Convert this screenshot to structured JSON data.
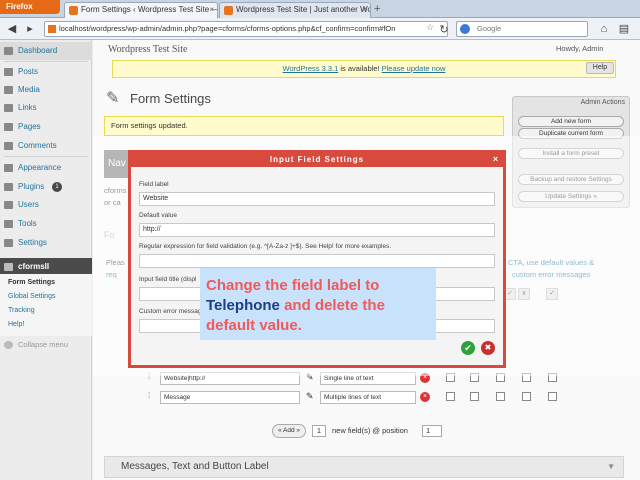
{
  "browser": {
    "app_button": "Firefox",
    "tabs": [
      {
        "label": "Form Settings ‹ Wordpress Test Site — WordPress"
      },
      {
        "label": "Wordpress Test Site | Just another Wo..."
      }
    ],
    "url": "localhost/wordpress/wp-admin/admin.php?page=cforms/cforms-options.php&cf_confirm=confirm#fOn",
    "search_placeholder": "Google"
  },
  "wp": {
    "site_title": "Wordpress Test Site",
    "howdy": "Howdy, Admin",
    "notice_prefix": "WordPress 3.3.1",
    "notice_middle": " is available! ",
    "notice_link": "Please update now",
    "help": "Help",
    "menu": [
      "Dashboard",
      "Posts",
      "Media",
      "Links",
      "Pages",
      "Comments",
      "Appearance",
      "Plugins",
      "Users",
      "Tools",
      "Settings",
      "cformsII"
    ],
    "plugins_badge": "1",
    "submenu": [
      "Form Settings",
      "Global Settings",
      "Tracking",
      "Help!"
    ],
    "collapse": "Collapse menu",
    "page_title": "Form Settings",
    "updated_msg": "Form settings updated.",
    "admin_actions": {
      "title": "Admin Actions",
      "buttons": [
        "Add new form",
        "Duplicate current form",
        "Install a form preset",
        "Backup and restore Settings",
        "Update Settings »"
      ]
    },
    "frag_nav": "Nav",
    "frag_cforms": "cforms",
    "frag_or": "or ca",
    "frag_fo": "Fo",
    "frag_please": "Pleas",
    "frag_req": "req",
    "frag_cta": "CTA, use default values &",
    "frag_custom": "custom error messages",
    "col_headers": [
      "x",
      "✓",
      "✓"
    ],
    "rows": [
      {
        "field": "Website|http://",
        "type": "Single line of text"
      },
      {
        "field": "Message",
        "type": "Multiple lines of text"
      }
    ],
    "add_label": "« Add »",
    "add_count": "1",
    "add_text": "new field(s) @ position",
    "add_pos": "1",
    "msg_section": "Messages, Text and Button Label"
  },
  "dialog": {
    "title": "Input Field Settings",
    "field_label_caption": "Field label",
    "field_label_value": "Website",
    "default_caption": "Default value",
    "default_value": "http://",
    "regex_caption": "Regular expression for field validation (e.g. ^[A-Za-z ]+$). See Help! for more examples.",
    "regex_value": "",
    "title_caption": "Input field title (displ",
    "title_value": "",
    "custom_caption": "Custom error message",
    "custom_value": ""
  },
  "callout": {
    "part1": "Change the field label to",
    "highlight": "Telephone",
    "part2": " and delete the default value."
  }
}
